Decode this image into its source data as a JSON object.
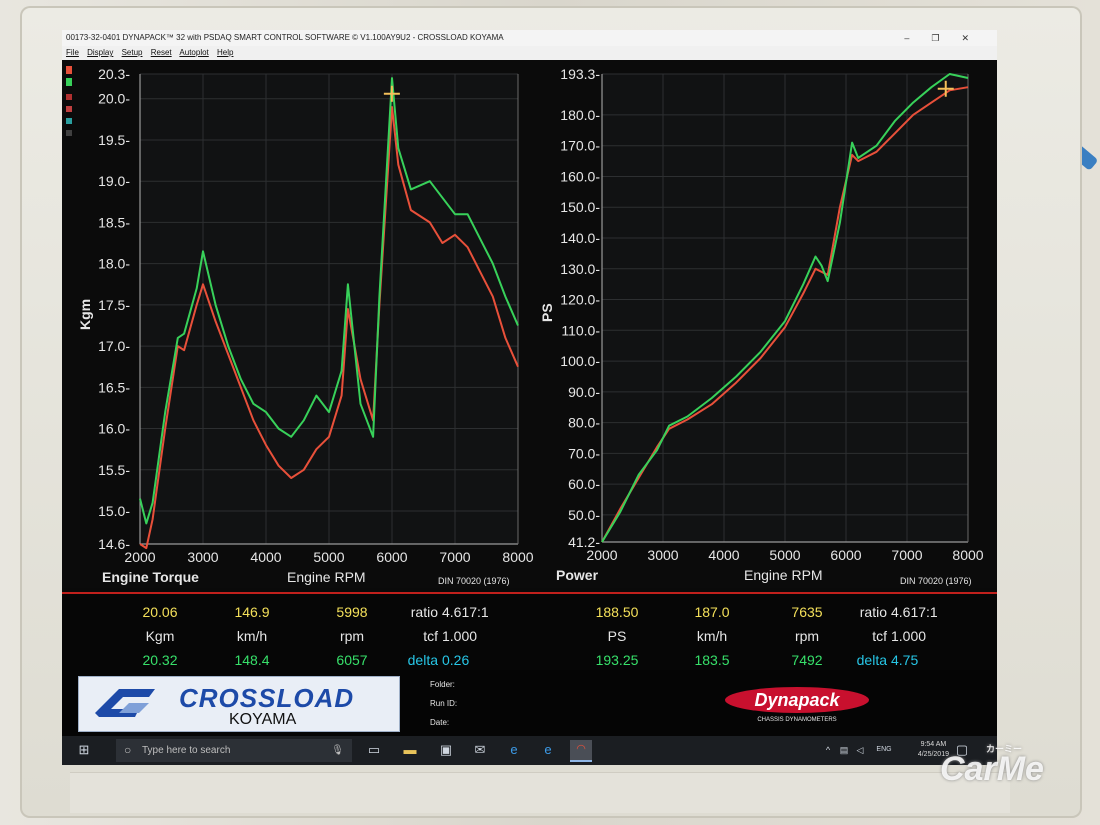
{
  "window": {
    "title": "00173-32-0401 DYNAPACK™ 32 with PSDAQ SMART CONTROL SOFTWARE © V1.100AY9U2 - CROSSLOAD KOYAMA",
    "controls": [
      "–",
      "❐",
      "✕"
    ]
  },
  "menu": [
    "File",
    "Display",
    "Setup",
    "Reset",
    "Autoplot",
    "Help"
  ],
  "colors": {
    "red": "#e8503a",
    "green": "#38d15a",
    "yellow": "#f4e05a",
    "cyan": "#27c6e6"
  },
  "chart_data": [
    {
      "type": "line",
      "title": "Engine Torque",
      "xlabel": "Engine RPM",
      "ylabel": "Kgm",
      "standard": "DIN 70020 (1976)",
      "xlim": [
        2000,
        8000
      ],
      "ylim": [
        14.6,
        20.3
      ],
      "x_ticks": [
        "2000",
        "3000",
        "4000",
        "5000",
        "6000",
        "7000",
        "8000"
      ],
      "y_ticks": [
        "20.3-",
        "20.0-",
        "19.5-",
        "19.0-",
        "18.5-",
        "18.0-",
        "17.5-",
        "17.0-",
        "16.5-",
        "16.0-",
        "15.5-",
        "15.0-",
        "14.6-"
      ],
      "y_tick_values": [
        20.3,
        20.0,
        19.5,
        19.0,
        18.5,
        18.0,
        17.5,
        17.0,
        16.5,
        16.0,
        15.5,
        15.0,
        14.6
      ],
      "cursor": {
        "x": 5998,
        "y": 20.06
      },
      "series": [
        {
          "color": "#e8503a",
          "x": [
            2000,
            2100,
            2200,
            2400,
            2600,
            2700,
            2900,
            3000,
            3200,
            3400,
            3600,
            3800,
            4000,
            4200,
            4400,
            4600,
            4800,
            5000,
            5200,
            5300,
            5500,
            5700,
            5800,
            6000,
            6100,
            6300,
            6600,
            6800,
            7000,
            7200,
            7400,
            7600,
            7800,
            8000
          ],
          "y": [
            14.6,
            14.55,
            14.9,
            16.0,
            17.0,
            16.95,
            17.5,
            17.75,
            17.3,
            16.9,
            16.5,
            16.1,
            15.8,
            15.55,
            15.4,
            15.5,
            15.75,
            15.9,
            16.4,
            17.45,
            16.6,
            16.1,
            17.5,
            19.9,
            19.2,
            18.65,
            18.5,
            18.25,
            18.35,
            18.2,
            17.9,
            17.6,
            17.1,
            16.75
          ]
        },
        {
          "color": "#38d15a",
          "x": [
            2000,
            2100,
            2200,
            2400,
            2600,
            2700,
            2900,
            3000,
            3200,
            3400,
            3600,
            3800,
            4000,
            4200,
            4400,
            4600,
            4800,
            5000,
            5200,
            5300,
            5500,
            5700,
            5800,
            6000,
            6100,
            6300,
            6600,
            6800,
            7000,
            7200,
            7400,
            7600,
            7800,
            8000
          ],
          "y": [
            15.15,
            14.85,
            15.1,
            16.2,
            17.1,
            17.15,
            17.7,
            18.15,
            17.5,
            17.0,
            16.6,
            16.3,
            16.2,
            16.0,
            15.9,
            16.1,
            16.4,
            16.2,
            16.7,
            17.75,
            16.3,
            15.9,
            17.6,
            20.25,
            19.4,
            18.9,
            19.0,
            18.8,
            18.6,
            18.6,
            18.3,
            18.0,
            17.6,
            17.25
          ]
        }
      ]
    },
    {
      "type": "line",
      "title": "Power",
      "xlabel": "Engine RPM",
      "ylabel": "PS",
      "standard": "DIN 70020 (1976)",
      "xlim": [
        2000,
        8000
      ],
      "ylim": [
        41.2,
        193.3
      ],
      "x_ticks": [
        "2000",
        "3000",
        "4000",
        "5000",
        "6000",
        "7000",
        "8000"
      ],
      "y_ticks": [
        "193.3-",
        "180.0-",
        "170.0-",
        "160.0-",
        "150.0-",
        "140.0-",
        "130.0-",
        "120.0-",
        "110.0-",
        "100.0-",
        "90.0-",
        "80.0-",
        "70.0-",
        "60.0-",
        "50.0-",
        "41.2-"
      ],
      "y_tick_values": [
        193.3,
        180,
        170,
        160,
        150,
        140,
        130,
        120,
        110,
        100,
        90,
        80,
        70,
        60,
        50,
        41.2
      ],
      "cursor": {
        "x": 7635,
        "y": 188.5
      },
      "series": [
        {
          "color": "#e8503a",
          "x": [
            2000,
            2300,
            2600,
            2900,
            3100,
            3400,
            3800,
            4200,
            4600,
            5000,
            5300,
            5500,
            5700,
            5900,
            6100,
            6200,
            6500,
            6800,
            7100,
            7400,
            7700,
            8000
          ],
          "y": [
            41.2,
            52,
            62,
            72,
            78,
            81,
            86,
            93,
            101,
            111,
            122,
            130,
            128,
            150,
            167,
            165,
            168,
            174,
            180,
            184,
            188,
            189
          ]
        },
        {
          "color": "#38d15a",
          "x": [
            2000,
            2300,
            2600,
            2900,
            3100,
            3400,
            3800,
            4200,
            4600,
            5000,
            5300,
            5500,
            5600,
            5700,
            5900,
            6100,
            6200,
            6500,
            6800,
            7100,
            7400,
            7700,
            8000
          ],
          "y": [
            41.2,
            51,
            63,
            71,
            79,
            82,
            88,
            95,
            103,
            113,
            125,
            134,
            131,
            126,
            145,
            171,
            166,
            170,
            178,
            184,
            189,
            193.3,
            192
          ]
        }
      ]
    }
  ],
  "readout": {
    "left": {
      "row1": [
        "20.06",
        "146.9",
        "5998"
      ],
      "row2": [
        "Kgm",
        "km/h",
        "rpm"
      ],
      "row3": [
        "20.32",
        "148.4",
        "6057"
      ],
      "ratio_label": "ratio",
      "ratio_value": "4.617:1",
      "tcf_label": "tcf",
      "tcf_value": "1.000",
      "delta_label": "delta",
      "delta_value": "0.26"
    },
    "right": {
      "row1": [
        "188.50",
        "187.0",
        "7635"
      ],
      "row2": [
        "PS",
        "km/h",
        "rpm"
      ],
      "row3": [
        "193.25",
        "183.5",
        "7492"
      ],
      "ratio_label": "ratio",
      "ratio_value": "4.617:1",
      "tcf_label": "tcf",
      "tcf_value": "1.000",
      "delta_label": "delta",
      "delta_value": "4.75"
    }
  },
  "footer": {
    "logo_main": "CROSSLOAD",
    "logo_sub": "KOYAMA",
    "folder_label": "Folder:",
    "runid_label": "Run ID:",
    "date_label": "Date:",
    "brand": "Dynapack",
    "brand_sub": "CHASSIS DYNAMOMETERS"
  },
  "taskbar": {
    "search_placeholder": "Type here to search",
    "lang": "ENG",
    "time": "9:54 AM",
    "date": "4/25/2019"
  },
  "watermark": {
    "main": "CarMe",
    "sub": "カーミー"
  }
}
